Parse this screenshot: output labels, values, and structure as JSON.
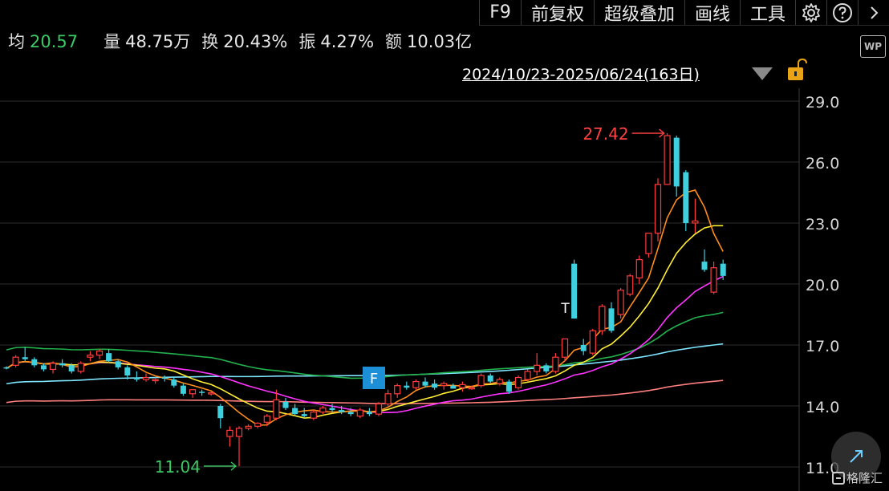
{
  "toolbar": {
    "items": [
      "F9",
      "前复权",
      "超级叠加",
      "画线",
      "工具"
    ],
    "settings_icon": "gear-icon",
    "help_icon": "help-icon",
    "next_icon": "chevron-right-icon"
  },
  "stats": [
    {
      "label": "均",
      "value": "20.57",
      "color": "green"
    },
    {
      "label": "量",
      "value": "48.75万"
    },
    {
      "label": "换",
      "value": "20.43%"
    },
    {
      "label": "振",
      "value": "4.27%"
    },
    {
      "label": "额",
      "value": "10.03亿"
    }
  ],
  "wp_label": "WP",
  "date_range": "2024/10/23-2025/06/24(163日)",
  "watermark": "格隆汇",
  "chart_data": {
    "type": "candlestick",
    "ylim": [
      11,
      29
    ],
    "yticks": [
      "29.0",
      "26.0",
      "23.0",
      "20.0",
      "17.0",
      "14.0",
      "11.0"
    ],
    "grid": true,
    "max_label": "27.42",
    "min_label": "11.04",
    "markers": [
      {
        "text": "F"
      },
      {
        "text": "T"
      }
    ],
    "colors": {
      "up": "#ff3b3b",
      "down": "#3fd0e0",
      "ma5": "#ff8c1a",
      "ma10": "#ffee33",
      "ma20": "#ff33ff",
      "ma60": "#22b14c",
      "ma120": "#7fe6ff",
      "ma250": "#ff7f7f"
    },
    "candles": [
      [
        15.9,
        15.95,
        15.8,
        15.85
      ],
      [
        16.0,
        16.5,
        15.9,
        16.4
      ],
      [
        16.4,
        16.9,
        16.2,
        16.3
      ],
      [
        16.3,
        16.4,
        15.9,
        16.0
      ],
      [
        16.0,
        16.1,
        15.7,
        15.8
      ],
      [
        15.8,
        16.2,
        15.6,
        16.1
      ],
      [
        16.1,
        16.3,
        15.9,
        16.0
      ],
      [
        16.0,
        16.1,
        15.6,
        15.7
      ],
      [
        15.7,
        16.2,
        15.6,
        16.1
      ],
      [
        16.4,
        16.7,
        16.2,
        16.5
      ],
      [
        16.5,
        16.8,
        16.3,
        16.7
      ],
      [
        16.6,
        16.8,
        16.1,
        16.2
      ],
      [
        16.2,
        16.3,
        15.8,
        15.9
      ],
      [
        15.9,
        16.0,
        15.3,
        15.5
      ],
      [
        15.4,
        15.7,
        15.2,
        15.3
      ],
      [
        15.3,
        15.6,
        15.2,
        15.4
      ],
      [
        15.25,
        15.4,
        15.1,
        15.3
      ],
      [
        15.4,
        15.5,
        15.2,
        15.35
      ],
      [
        15.3,
        15.4,
        14.9,
        15.0
      ],
      [
        15.0,
        15.1,
        14.5,
        14.6
      ],
      [
        14.6,
        14.8,
        14.4,
        14.8
      ],
      [
        14.7,
        14.8,
        14.5,
        14.65
      ],
      [
        14.6,
        14.7,
        14.5,
        14.65
      ],
      [
        14.0,
        14.1,
        12.9,
        13.4
      ],
      [
        12.5,
        13.0,
        12.0,
        12.8
      ],
      [
        12.5,
        13.0,
        11.04,
        12.9
      ],
      [
        12.9,
        13.1,
        12.8,
        13.0
      ],
      [
        13.0,
        13.2,
        12.9,
        13.15
      ],
      [
        13.2,
        13.6,
        13.0,
        13.5
      ],
      [
        13.4,
        14.8,
        13.3,
        14.3
      ],
      [
        14.2,
        14.4,
        13.8,
        13.9
      ],
      [
        13.9,
        14.1,
        13.5,
        13.6
      ],
      [
        13.6,
        13.9,
        13.4,
        13.5
      ],
      [
        13.4,
        13.8,
        13.3,
        13.7
      ],
      [
        13.7,
        14.0,
        13.6,
        13.9
      ],
      [
        13.9,
        14.1,
        13.7,
        13.8
      ],
      [
        13.8,
        14.0,
        13.6,
        13.7
      ],
      [
        13.7,
        13.9,
        13.5,
        13.6
      ],
      [
        13.5,
        13.9,
        13.4,
        13.8
      ],
      [
        13.7,
        13.9,
        13.5,
        13.6
      ],
      [
        13.6,
        14.2,
        13.5,
        14.1
      ],
      [
        14.1,
        14.8,
        14.0,
        14.6
      ],
      [
        14.6,
        15.1,
        14.4,
        15.0
      ],
      [
        15.0,
        15.2,
        14.8,
        14.9
      ],
      [
        14.9,
        15.3,
        14.8,
        15.2
      ],
      [
        15.2,
        15.4,
        14.9,
        15.0
      ],
      [
        15.1,
        15.3,
        14.8,
        14.9
      ],
      [
        15.0,
        15.2,
        14.8,
        15.1
      ],
      [
        15.0,
        15.1,
        14.9,
        14.85
      ],
      [
        14.9,
        15.2,
        14.7,
        15.05
      ],
      [
        14.9,
        15.0,
        14.8,
        14.9
      ],
      [
        15.0,
        15.6,
        14.9,
        15.5
      ],
      [
        15.5,
        15.6,
        15.1,
        15.2
      ],
      [
        15.1,
        15.4,
        15.0,
        15.3
      ],
      [
        15.2,
        15.3,
        14.6,
        14.7
      ],
      [
        14.9,
        15.5,
        14.8,
        15.4
      ],
      [
        15.3,
        15.8,
        15.2,
        15.7
      ],
      [
        15.7,
        16.6,
        15.5,
        16.0
      ],
      [
        16.0,
        16.1,
        15.6,
        15.7
      ],
      [
        15.7,
        16.6,
        15.6,
        16.4
      ],
      [
        16.4,
        17.3,
        16.2,
        17.3
      ],
      [
        21.0,
        21.2,
        18.3,
        18.3
      ],
      [
        17.0,
        17.3,
        16.5,
        16.7
      ],
      [
        16.6,
        17.8,
        16.5,
        17.7
      ],
      [
        17.7,
        19.0,
        17.5,
        18.9
      ],
      [
        18.8,
        19.1,
        17.6,
        17.7
      ],
      [
        18.5,
        19.8,
        18.3,
        19.7
      ],
      [
        19.5,
        20.5,
        19.4,
        20.4
      ],
      [
        20.3,
        21.4,
        20.0,
        21.2
      ],
      [
        21.5,
        22.5,
        21.3,
        22.5
      ],
      [
        22.5,
        25.2,
        22.1,
        24.9
      ],
      [
        24.9,
        27.42,
        24.9,
        27.3
      ],
      [
        27.2,
        27.3,
        24.3,
        24.8
      ],
      [
        25.5,
        25.6,
        22.6,
        23.0
      ],
      [
        23.0,
        24.2,
        22.5,
        23.1
      ],
      [
        21.1,
        21.7,
        20.6,
        20.7
      ],
      [
        19.6,
        21.1,
        19.5,
        20.8
      ],
      [
        21.0,
        21.2,
        20.2,
        20.4
      ]
    ]
  }
}
